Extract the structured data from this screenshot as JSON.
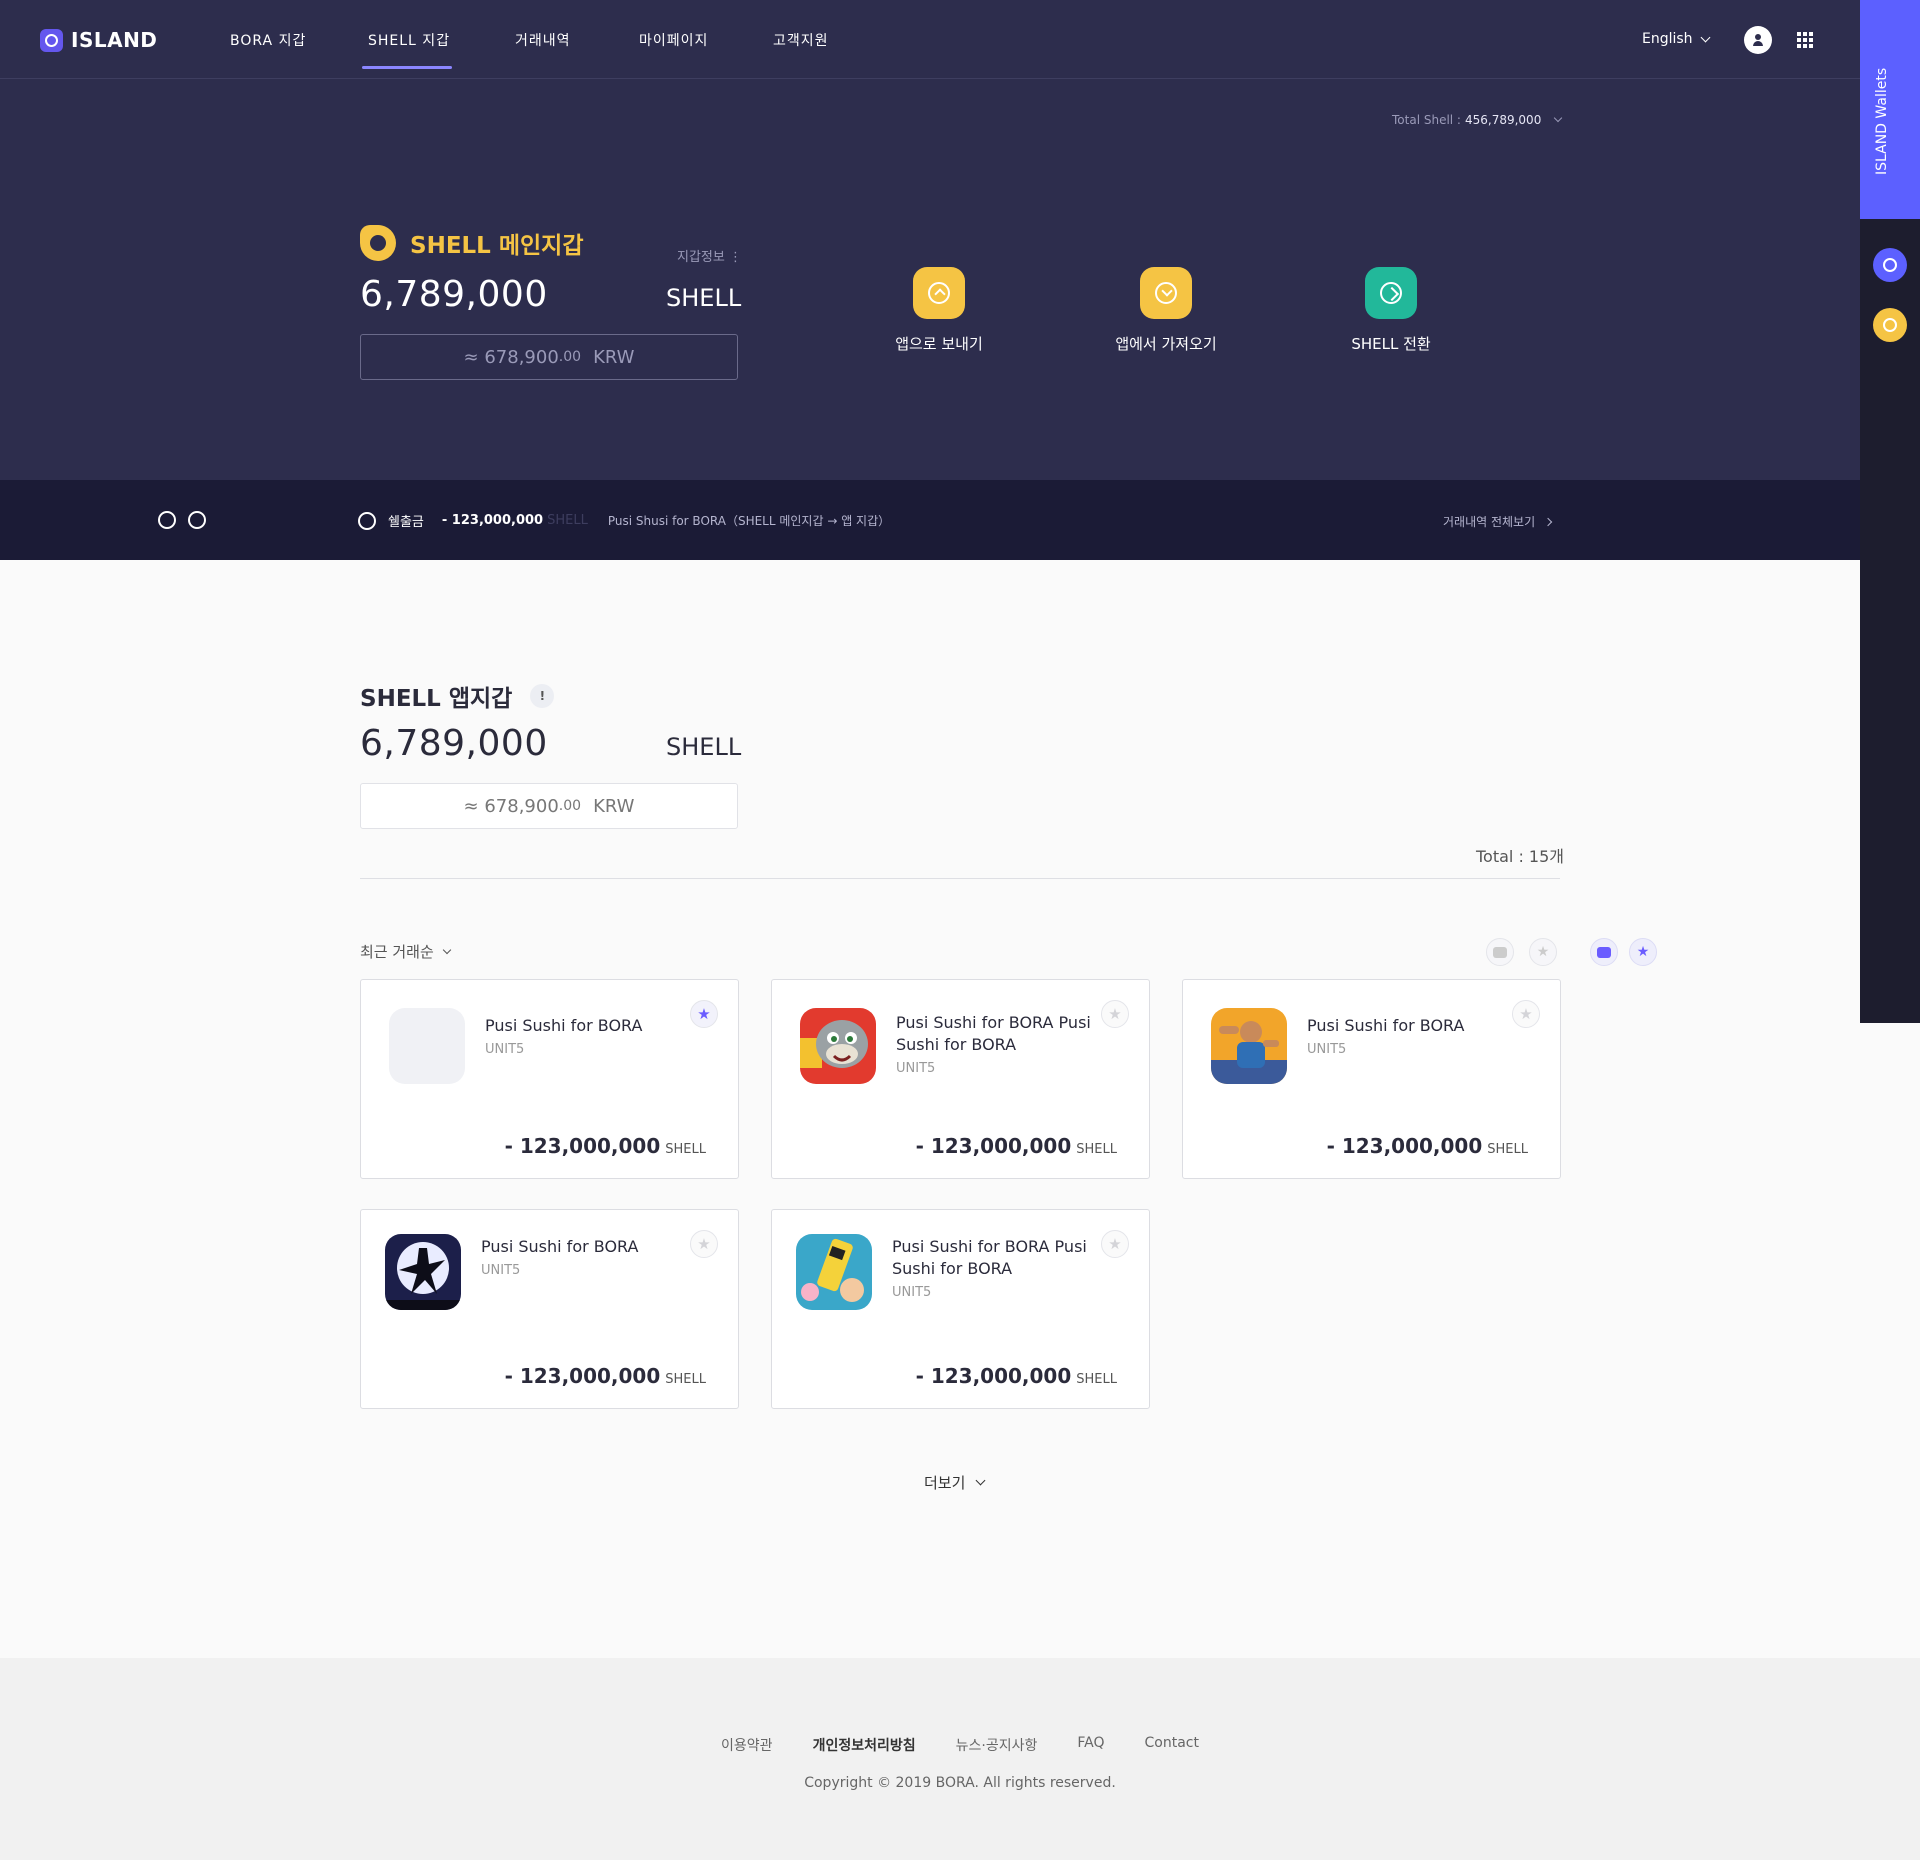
{
  "brand": {
    "name": "ISLAND",
    "accent": "#6457ee"
  },
  "nav": {
    "items": [
      "BORA 지갑",
      "SHELL 지갑",
      "거래내역",
      "마이페이지",
      "고객지원"
    ],
    "active": "SHELL 지갑",
    "language": "English"
  },
  "total_shell": {
    "label": "Total Shell :",
    "value": "456,789,000"
  },
  "main_wallet": {
    "title": "SHELL 메인지갑",
    "info_label": "지갑정보",
    "amount": "6,789,000",
    "unit": "SHELL",
    "krw_prefix": "≈ 678,900",
    "krw_decimal": ".00",
    "krw_unit": "KRW"
  },
  "actions": [
    {
      "label": "앱으로 보내기",
      "icon": "send-up-icon",
      "color": "#f5c444"
    },
    {
      "label": "앱에서 가져오기",
      "icon": "receive-down-icon",
      "color": "#f5c444"
    },
    {
      "label": "SHELL 전환",
      "icon": "swap-icon",
      "color": "#22b89a"
    }
  ],
  "tx_bar": {
    "type_label": "쉘출금",
    "amount": "- 123,000,000",
    "unit": "SHELL",
    "description": "Pusi Shusi for BORA（SHELL 메인지갑 → 앱 지갑）",
    "view_all": "거래내역 전체보기"
  },
  "rail": {
    "tab_label": "ISLAND Wallets",
    "colors": [
      "#5c60ff",
      "#f5c444"
    ]
  },
  "app_wallet": {
    "title": "SHELL 앱지갑",
    "info_badge": "!",
    "amount": "6,789,000",
    "unit": "SHELL",
    "krw_prefix": "≈ 678,900",
    "krw_decimal": ".00",
    "krw_unit": "KRW",
    "total_count": "Total : 15개",
    "sort_label": "최근 거래순"
  },
  "cards": [
    {
      "name": "Pusi Sushi for BORA",
      "sub": "UNIT5",
      "amount": "- 123,000,000",
      "unit": "SHELL",
      "favorite": true,
      "thumb": "blank"
    },
    {
      "name": "Pusi Sushi for BORA Pusi Sushi for BORA",
      "sub": "UNIT5",
      "amount": "- 123,000,000",
      "unit": "SHELL",
      "favorite": false,
      "thumb": "cat"
    },
    {
      "name": "Pusi Sushi for BORA",
      "sub": "UNIT5",
      "amount": "- 123,000,000",
      "unit": "SHELL",
      "favorite": false,
      "thumb": "warrior"
    },
    {
      "name": "Pusi Sushi for BORA",
      "sub": "UNIT5",
      "amount": "- 123,000,000",
      "unit": "SHELL",
      "favorite": false,
      "thumb": "ninja"
    },
    {
      "name": "Pusi Sushi for BORA Pusi Sushi for BORA",
      "sub": "UNIT5",
      "amount": "- 123,000,000",
      "unit": "SHELL",
      "favorite": false,
      "thumb": "pencil"
    }
  ],
  "more_label": "더보기",
  "footer": {
    "links": [
      "이용약관",
      "개인정보처리방침",
      "뉴스·공지사항",
      "FAQ",
      "Contact"
    ],
    "copyright": "Copyright © 2019 BORA. All rights reserved."
  }
}
